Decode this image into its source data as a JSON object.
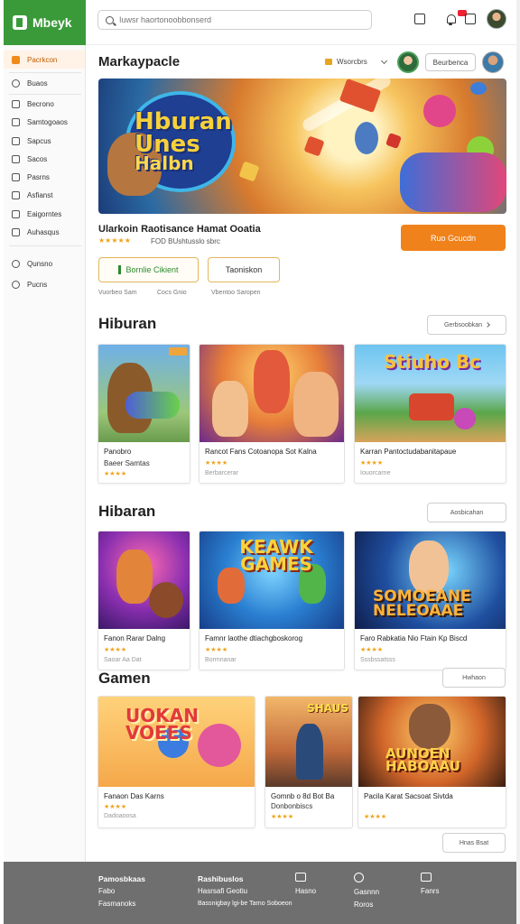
{
  "app": {
    "brand_name": "Mbeyk"
  },
  "sidebar": {
    "items": [
      {
        "label": "Pacrkcon",
        "icon": "home-icon",
        "active": true
      },
      {
        "label": "Buaos",
        "icon": "search-icon"
      },
      {
        "label": "Becrono",
        "icon": "calendar-icon"
      },
      {
        "label": "Samtogoaos",
        "icon": "grid-icon"
      },
      {
        "label": "Sapcus",
        "icon": "chart-icon"
      },
      {
        "label": "Sacos",
        "icon": "tag-icon"
      },
      {
        "label": "Pasrns",
        "icon": "box-icon"
      },
      {
        "label": "Asfianst",
        "icon": "bookmark-icon"
      },
      {
        "label": "Eaigorntes",
        "icon": "document-icon"
      },
      {
        "label": "Auhasqus",
        "icon": "layers-icon"
      },
      {
        "label": "Qunsno",
        "icon": "clock-icon"
      },
      {
        "label": "Pucns",
        "icon": "user-icon"
      }
    ]
  },
  "topbar": {
    "search_placeholder": "Iuwsr haortonoobbonserd",
    "icons": [
      "message-icon",
      "bell-icon",
      "mail-icon",
      "avatar"
    ],
    "notification_color": "#e22233"
  },
  "main": {
    "page_title": "Markaypacle",
    "location_label": "Wsorcbrs",
    "profile_button": "Beurbenca",
    "hero": {
      "art_title_lines": [
        "Hburan",
        "Unes",
        "Halbn"
      ],
      "product_name": "Ularkoin Raotisance Hamat Ooatia",
      "rating": 5,
      "meta": "FOD BUshtusslo sbrc",
      "primary_button": "Ruo Gcucdn",
      "accent_color": "#f0821c",
      "secondary_buttons": [
        "Bornlie Cikient",
        "Taoniskon"
      ],
      "captions": [
        "Vuorbeo Sam",
        "Cocs Gnio",
        "Vbentoo Saropen"
      ]
    },
    "sections": [
      {
        "title": "Hiburan",
        "button": "Gerbsoobkan",
        "cards": [
          {
            "line1": "Panobro",
            "line2": "Baeer Samtas",
            "rating": 4,
            "meta": "",
            "art": ""
          },
          {
            "line1": "Rancot Fans Cotoanopa Sot Kalna",
            "line2": "",
            "rating": 4,
            "meta": "Berbarcerar",
            "art": ""
          },
          {
            "line1": "Karran Pantoctudabanitapaue",
            "line2": "",
            "rating": 4,
            "meta": "Iouorcarne",
            "art": "Stiuho Bc"
          }
        ]
      },
      {
        "title": "Hibaran",
        "button": "Aosbicahan",
        "cards": [
          {
            "line1": "Fanon Rarar Dalng",
            "line2": "",
            "rating": 4,
            "meta": "Saoar Aa Dat",
            "art": ""
          },
          {
            "line1": "Famnr laothe dtiachgboskorog",
            "line2": "",
            "rating": 4,
            "meta": "Bormnanar",
            "art": "KEAWK GAMES"
          },
          {
            "line1": "Faro Rabkatia Nio Ftain Kp Biscd",
            "line2": "",
            "rating": 4,
            "meta": "Sssbssatsss",
            "art": "SOMOEANE NELEOAAE"
          }
        ]
      },
      {
        "title": "Gamen",
        "button": "Hwhaon",
        "cards": [
          {
            "line1": "Fanaon Das Karns",
            "line2": "",
            "rating": 4,
            "meta": "Dadoaoosa",
            "art": "UOKAN VOEES"
          },
          {
            "line1": "Gomnb o 8d Bot Ba",
            "line2": "Donbonbiscs",
            "rating": 4,
            "meta": "",
            "art": "SHAUS"
          },
          {
            "line1": "Pacila Karat Sacsoat Sivtda",
            "line2": "",
            "rating": 4,
            "meta": "",
            "art": "AUNOEN HABOAAU"
          }
        ]
      }
    ],
    "more_button": "Hnas Bsat"
  },
  "footer": {
    "columns": [
      {
        "heading": "Pamosbkaas",
        "lines": [
          "Fabo",
          "Fasmanoks"
        ]
      },
      {
        "heading": "Rashibuslos",
        "lines": [
          "Hasrsafi Geotiu",
          "Bassnigbay lgi-be Tarno Soboeon"
        ]
      }
    ],
    "icon_links": [
      {
        "icon": "grid-icon",
        "label": "Hasno"
      },
      {
        "icon": "help-icon",
        "label": "Gasnnn",
        "sub": "Roros"
      },
      {
        "icon": "card-icon",
        "label": "Fanrs"
      }
    ],
    "background": "#6f6f6f"
  }
}
